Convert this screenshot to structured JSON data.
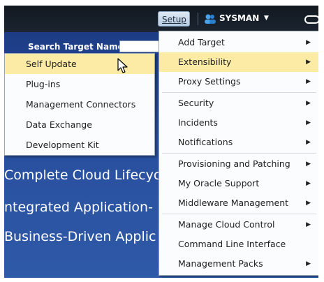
{
  "topbar": {
    "setup_label": "Setup",
    "user_name": "SYSMAN"
  },
  "search": {
    "label": "Search Target Name"
  },
  "banner": {
    "lines": [
      "Complete Cloud Lifecyc",
      "ntegrated Application-",
      "Business-Driven Applic"
    ]
  },
  "extensibility_submenu": {
    "items": [
      "Self Update",
      "Plug-ins",
      "Management Connectors",
      "Data Exchange",
      "Development Kit"
    ]
  },
  "setup_menu": {
    "items": [
      {
        "label": "Add Target",
        "submenu": true
      },
      {
        "label": "Extensibility",
        "submenu": true
      },
      {
        "label": "Proxy Settings",
        "submenu": true
      },
      {
        "label": "Security",
        "submenu": true
      },
      {
        "label": "Incidents",
        "submenu": true
      },
      {
        "label": "Notifications",
        "submenu": true
      },
      {
        "label": "Provisioning and Patching",
        "submenu": true
      },
      {
        "label": "My Oracle Support",
        "submenu": true
      },
      {
        "label": "Middleware Management",
        "submenu": true
      },
      {
        "label": "Manage Cloud Control",
        "submenu": true
      },
      {
        "label": "Command Line Interface",
        "submenu": false
      },
      {
        "label": "Management Packs",
        "submenu": true
      }
    ]
  },
  "colors": {
    "topbar": "#111820",
    "banner_blue": "#274e9c",
    "highlight": "#fbeba4"
  }
}
